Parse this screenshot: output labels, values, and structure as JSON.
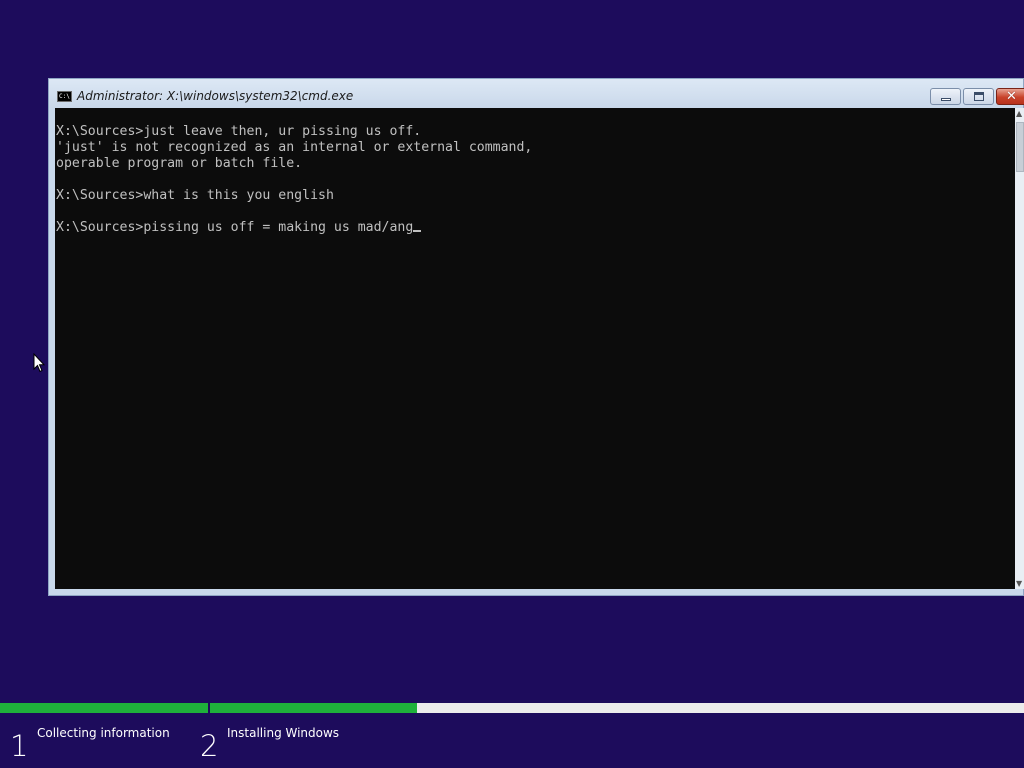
{
  "window": {
    "title": "Administrator: X:\\windows\\system32\\cmd.exe",
    "icon": "cmd-icon",
    "icon_glyph": "C:\\",
    "buttons": {
      "minimize": "minimize-icon",
      "maximize": "maximize-icon",
      "close": "close-icon",
      "close_glyph": "✕"
    }
  },
  "console": {
    "lines": [
      "X:\\Sources>just leave then, ur pissing us off.",
      "'just' is not recognized as an internal or external command,",
      "operable program or batch file.",
      "",
      "X:\\Sources>what is this you english",
      "",
      "X:\\Sources>pissing us off = making us mad/ang"
    ],
    "text_color": "#c0c0c0",
    "background_color": "#0c0c0c"
  },
  "scrollbar": {
    "up_arrow": "▲",
    "down_arrow": "▼"
  },
  "setup": {
    "background_color": "#1d0c5c",
    "progress_color": "#1fb13b",
    "steps": [
      {
        "number": "1",
        "label": "Collecting information",
        "progress": 1.0
      },
      {
        "number": "2",
        "label": "Installing Windows",
        "progress": 0.254
      }
    ]
  }
}
